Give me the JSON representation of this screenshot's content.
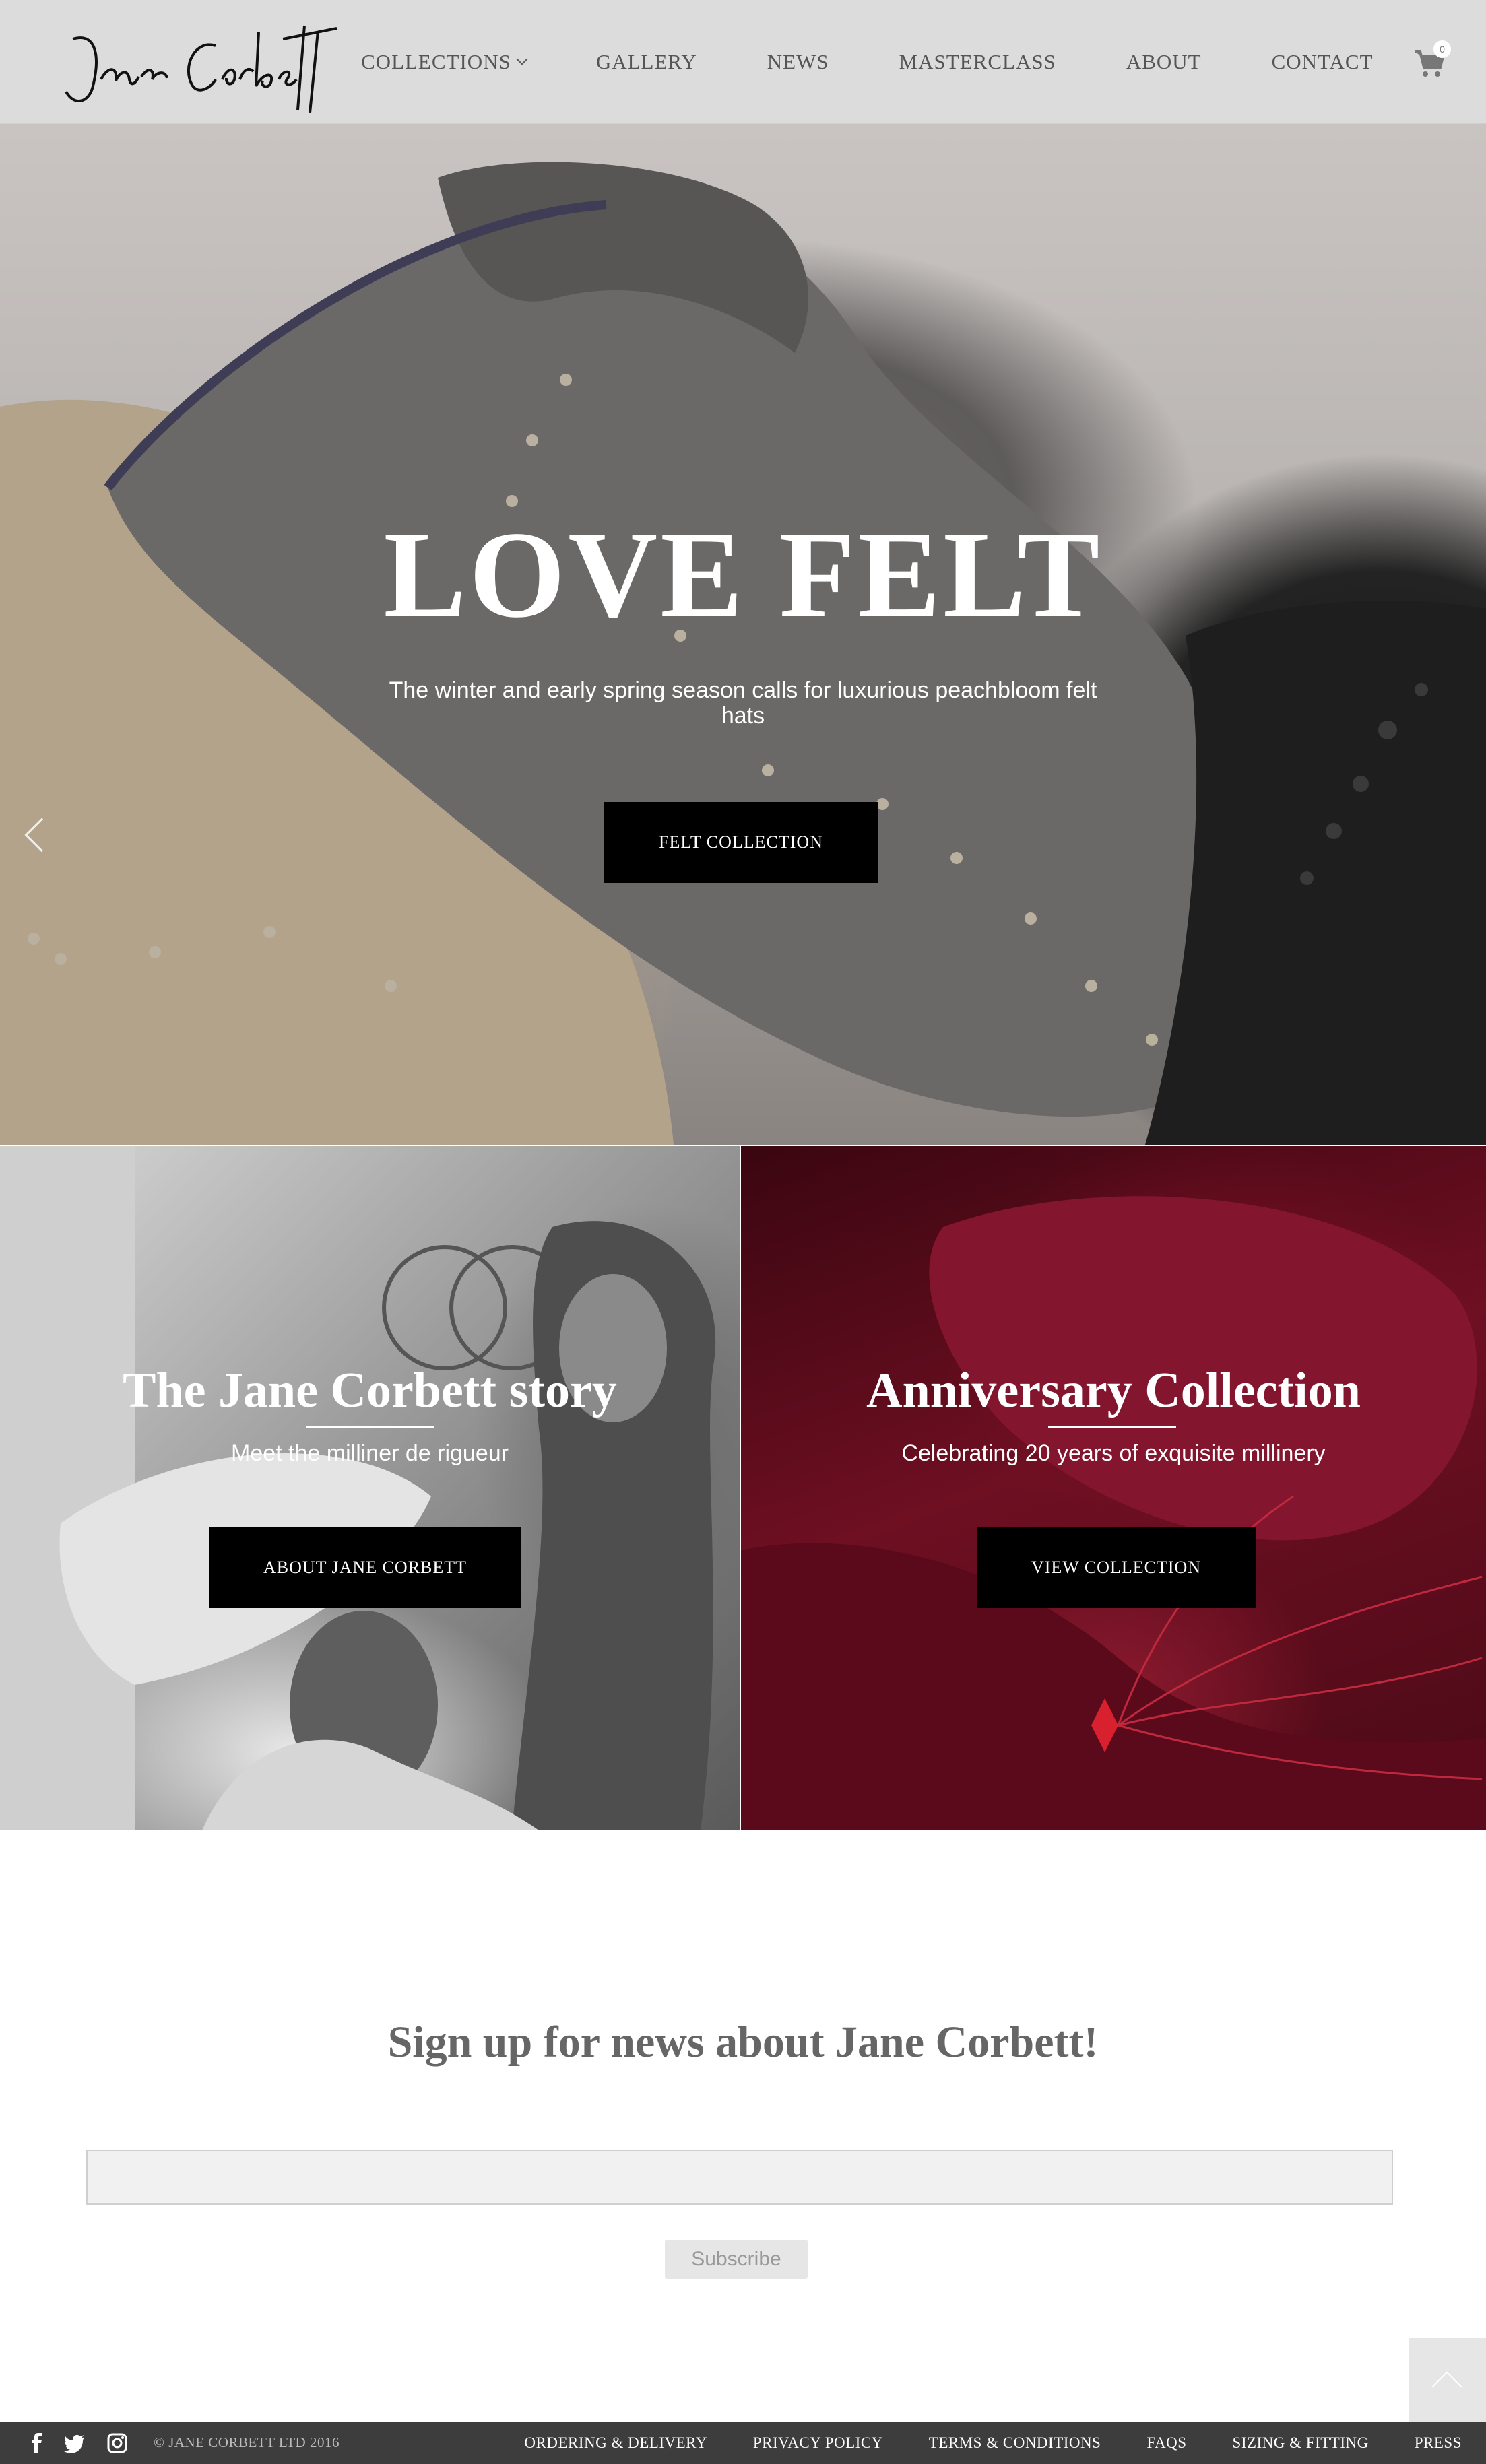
{
  "header": {
    "logo_text": "Jane Corbett",
    "nav": [
      {
        "label": "COLLECTIONS",
        "has_dropdown": true
      },
      {
        "label": "GALLERY"
      },
      {
        "label": "NEWS"
      },
      {
        "label": "MASTERCLASS"
      },
      {
        "label": "ABOUT"
      },
      {
        "label": "CONTACT"
      }
    ],
    "cart_count": "0",
    "cart_icon": "shopping-cart-icon"
  },
  "hero": {
    "title": "LOVE FELT",
    "subtitle": "The winter and early spring season calls for luxurious peachbloom felt hats",
    "button_label": "FELT COLLECTION",
    "prev_icon": "chevron-left-icon"
  },
  "promos": {
    "left": {
      "title": "The Jane Corbett story",
      "subtitle": "Meet the milliner de rigueur",
      "button_label": "ABOUT JANE CORBETT"
    },
    "right": {
      "title": "Anniversary Collection",
      "subtitle": "Celebrating 20 years of exquisite millinery",
      "button_label": "VIEW COLLECTION"
    }
  },
  "signup": {
    "title": "Sign up for news about Jane Corbett!",
    "email_value": "",
    "button_label": "Subscribe"
  },
  "footer": {
    "social": [
      "facebook-icon",
      "twitter-icon",
      "instagram-icon"
    ],
    "copyright": "© JANE CORBETT LTD 2016",
    "links": [
      "ORDERING & DELIVERY",
      "PRIVACY POLICY",
      "TERMS & CONDITIONS",
      "FAQS",
      "SIZING & FITTING",
      "PRESS"
    ]
  },
  "colors": {
    "header_bg": "#dcdcdc",
    "button_bg": "#000000",
    "footer_bg": "#3d3d3d",
    "anniversary_bg": "#6e0f22"
  }
}
